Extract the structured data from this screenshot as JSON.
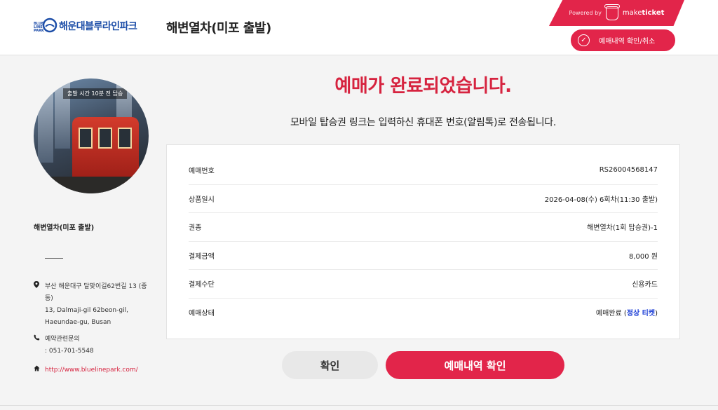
{
  "header": {
    "logo_small": "BLUE LINE PARK",
    "logo_text": "해운대블루라인파크",
    "page_title": "해변열차(미포 출발)",
    "powered_by": "Powered by",
    "brand_light": "make",
    "brand_bold": "ticket",
    "reservation_button": "예매내역 확인/취소"
  },
  "sidebar": {
    "photo_caption": "출발 시간 10분 전 탑승",
    "product_name": "해변열차(미포 출발)",
    "address_ko": "부산 해운대구 달맞이길62번길 13 (중동)",
    "address_en": "13, Dalmaji-gil 62beon-gil, Haeundae-gu, Busan",
    "contact_label": "예약관련문의",
    "contact_phone": ": 051-701-5548",
    "website": "http://www.bluelinepark.com/"
  },
  "main": {
    "title": "예매가 완료되었습니다.",
    "subtitle": "모바일 탑승권 링크는 입력하신 휴대폰 번호(알림톡)로 전송됩니다.",
    "rows": [
      {
        "label": "예매번호",
        "value": "RS26004568147"
      },
      {
        "label": "상품일시",
        "value": "2026-04-08(수) 6회차(11:30 출발)"
      },
      {
        "label": "권종",
        "value": "해변열차(1회 탑승권)-1"
      },
      {
        "label": "결제금액",
        "value": "8,000 원"
      },
      {
        "label": "결제수단",
        "value": "신용카드"
      },
      {
        "label": "예매상태",
        "value": "예매완료 (",
        "link": "정상 티켓",
        "suffix": ")"
      }
    ],
    "confirm_button": "확인",
    "check_button": "예매내역 확인"
  },
  "colors": {
    "accent": "#e2254a",
    "title_red": "#d6233f",
    "logo_blue": "#1d4ea8",
    "link_blue": "#1d3fd6"
  }
}
